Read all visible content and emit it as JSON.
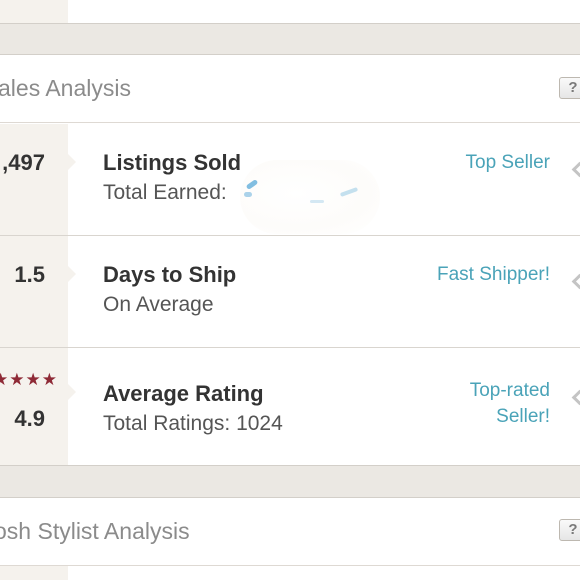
{
  "sales_analysis": {
    "title": "ales Analysis",
    "help_label": "?",
    "rows": [
      {
        "value": ",497",
        "title": "Listings Sold",
        "subtitle": "Total Earned:",
        "badge": "Top Seller"
      },
      {
        "value": "1.5",
        "title": "Days to Ship",
        "subtitle": "On Average",
        "badge": "Fast Shipper!"
      },
      {
        "value": "4.9",
        "stars": "★★★★",
        "title": "Average Rating",
        "subtitle": "Total Ratings: 1024",
        "badge": "Top-rated Seller!"
      }
    ]
  },
  "stylist_analysis": {
    "title": "osh Stylist Analysis",
    "help_label": "?"
  },
  "colors": {
    "accent_teal": "#4aa3b8",
    "star_red": "#8e2a36",
    "page_bg": "#ebe8e3"
  },
  "icons": [
    "help-icon",
    "chevron-right-icon",
    "star-icon"
  ]
}
